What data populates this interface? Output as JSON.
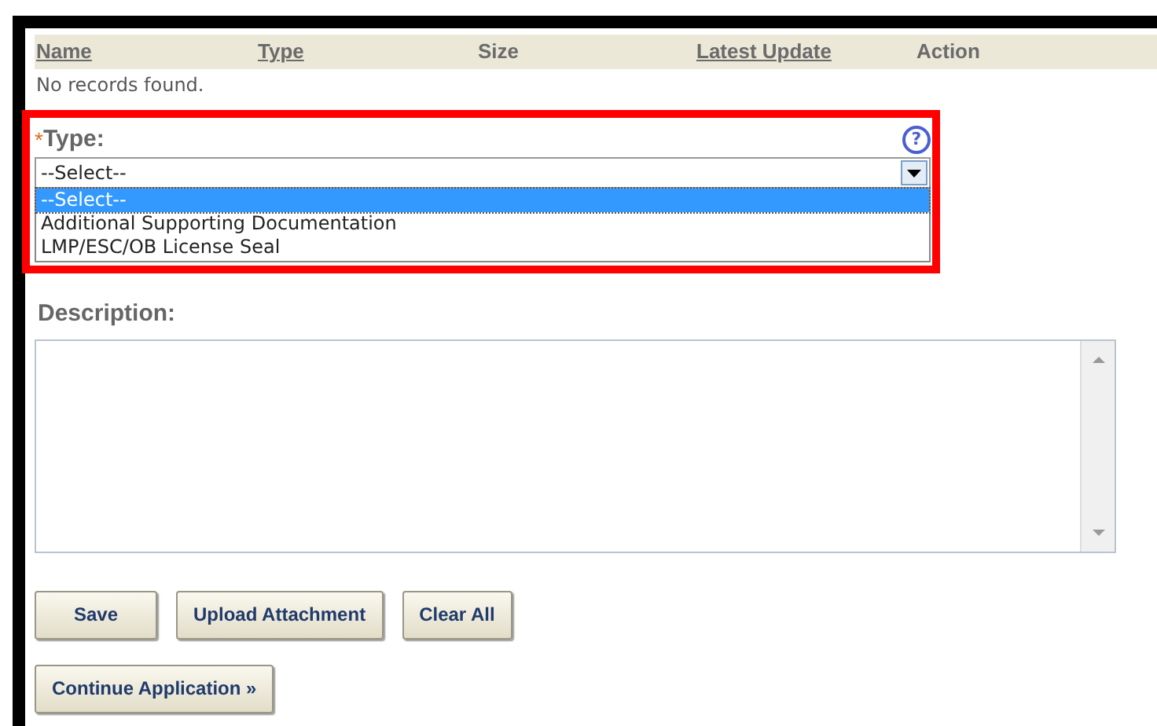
{
  "table": {
    "columns": [
      {
        "label": "Name",
        "sortable": true
      },
      {
        "label": "Type",
        "sortable": true
      },
      {
        "label": "Size",
        "sortable": false
      },
      {
        "label": "Latest Update",
        "sortable": true
      },
      {
        "label": "Action",
        "sortable": false
      }
    ],
    "empty_message": "No records found."
  },
  "type_field": {
    "required_mark": "*",
    "label": "Type:",
    "value": "--Select--",
    "help": "?",
    "options": [
      {
        "label": "--Select--",
        "selected": true
      },
      {
        "label": "Additional Supporting Documentation",
        "selected": false
      },
      {
        "label": "LMP/ESC/OB License Seal",
        "selected": false
      }
    ]
  },
  "description_field": {
    "label": "Description:"
  },
  "buttons": [
    "Save",
    "Upload Attachment",
    "Clear All"
  ],
  "continue_button": "Continue Application »"
}
